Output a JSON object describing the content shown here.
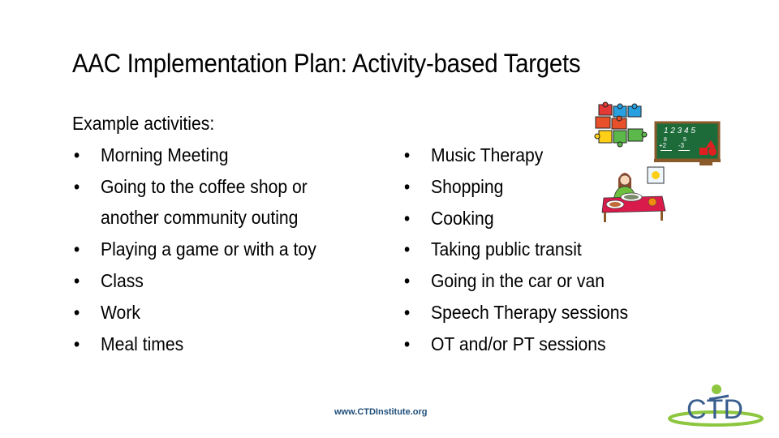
{
  "slide": {
    "title": "AAC Implementation Plan: Activity-based Targets",
    "left_column": {
      "heading": "Example activities:",
      "items": [
        {
          "text": "Morning Meeting"
        },
        {
          "text": "Going to the coffee shop or",
          "continuation": "another community outing"
        },
        {
          "text": "Playing a game or with a toy"
        },
        {
          "text": "Class"
        },
        {
          "text": "Work"
        },
        {
          "text": "Meal times"
        }
      ]
    },
    "right_column": {
      "items": [
        {
          "text": "Music Therapy"
        },
        {
          "text": "Shopping"
        },
        {
          "text": "Cooking"
        },
        {
          "text": "Taking public transit"
        },
        {
          "text": "Going in the car or van"
        },
        {
          "text": "Speech Therapy sessions"
        },
        {
          "text": "OT and/or PT sessions"
        }
      ]
    },
    "bullet_char": "•",
    "chalkboard": {
      "numbers": "1 2 3 4 5",
      "math1_top": "8",
      "math1_bottom": "+2",
      "math2_top": "5",
      "math2_bottom": "-3"
    },
    "footer_url": "www.CTDInstitute.org",
    "logo_text": "CTD",
    "colors": {
      "logo_blue": "#3a5f8f",
      "logo_green": "#8dc63f",
      "footer_text": "#1f4e79",
      "chalkboard": "#1e6b3a",
      "table": "#d81b4a"
    }
  }
}
